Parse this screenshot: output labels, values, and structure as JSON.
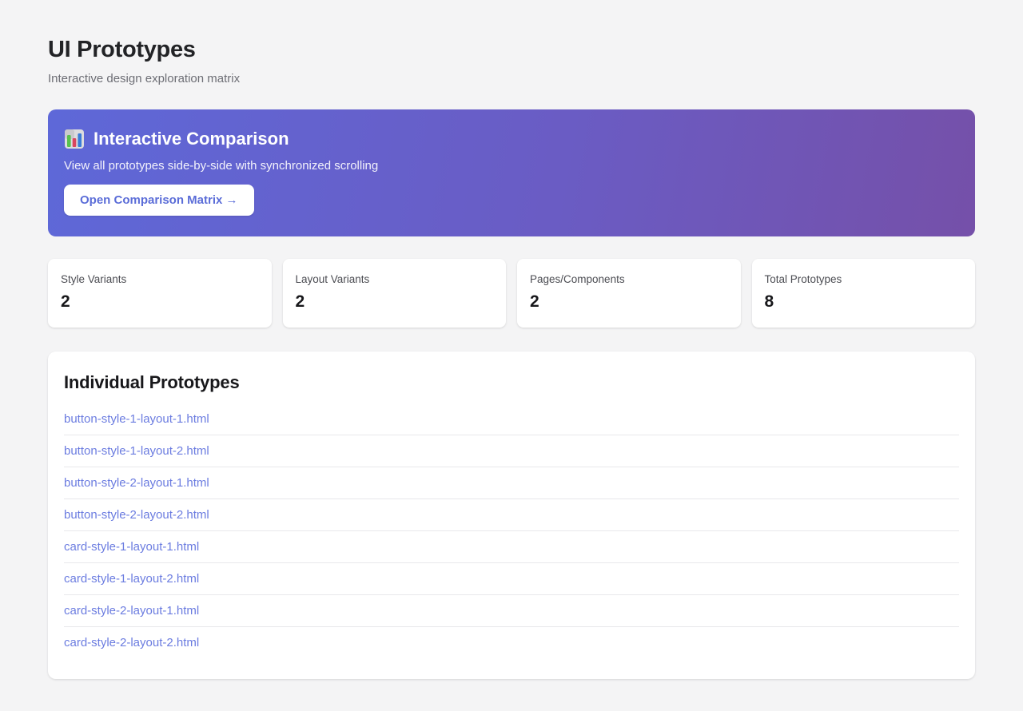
{
  "page": {
    "title": "UI Prototypes",
    "subtitle": "Interactive design exploration matrix"
  },
  "banner": {
    "icon": "bar-chart",
    "title": "Interactive Comparison",
    "description": "View all prototypes side-by-side with synchronized scrolling",
    "button_label": "Open Comparison Matrix →",
    "gradient_start": "#5e68d8",
    "gradient_end": "#7550a9",
    "button_text_color": "#5b6dd8"
  },
  "stats": [
    {
      "label": "Style Variants",
      "value": "2"
    },
    {
      "label": "Layout Variants",
      "value": "2"
    },
    {
      "label": "Pages/Components",
      "value": "2"
    },
    {
      "label": "Total Prototypes",
      "value": "8"
    }
  ],
  "prototypes": {
    "heading": "Individual Prototypes",
    "links": [
      "button-style-1-layout-1.html",
      "button-style-1-layout-2.html",
      "button-style-2-layout-1.html",
      "button-style-2-layout-2.html",
      "card-style-1-layout-1.html",
      "card-style-1-layout-2.html",
      "card-style-2-layout-1.html",
      "card-style-2-layout-2.html"
    ]
  },
  "colors": {
    "background": "#f4f4f5",
    "link": "#6b7ce0",
    "heading_text": "#18181b"
  }
}
